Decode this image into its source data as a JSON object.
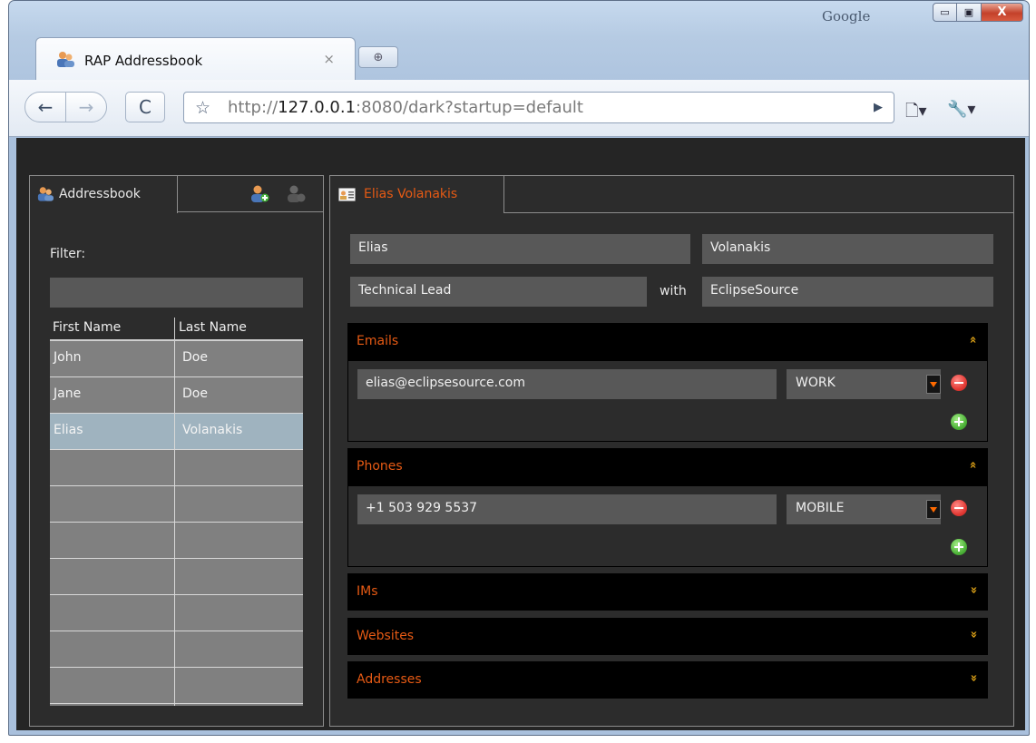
{
  "browser": {
    "tab_title": "RAP Addressbook",
    "tab_close": "×",
    "new_tab": "⊕",
    "corner_label": "Google",
    "window_buttons": {
      "minimize": "▭",
      "maximize": "▣",
      "close": "X"
    },
    "url_prefix": "http://",
    "url_host": "127.0.0.1",
    "url_rest": ":8080/dark?startup=default",
    "icons": {
      "back": "←",
      "forward": "→",
      "reload": "C",
      "star": "☆",
      "go": "▶",
      "page": "🗋▾",
      "tools": "🔧▾"
    }
  },
  "addressbook": {
    "tab_label": "Addressbook",
    "filter_label": "Filter:",
    "filter_value": "",
    "columns": [
      "First Name",
      "Last Name"
    ],
    "rows": [
      {
        "first": "John",
        "last": "Doe"
      },
      {
        "first": "Jane",
        "last": "Doe"
      },
      {
        "first": "Elias",
        "last": "Volanakis"
      },
      {
        "first": "",
        "last": ""
      },
      {
        "first": "",
        "last": ""
      },
      {
        "first": "",
        "last": ""
      },
      {
        "first": "",
        "last": ""
      },
      {
        "first": "",
        "last": ""
      },
      {
        "first": "",
        "last": ""
      },
      {
        "first": "",
        "last": ""
      }
    ],
    "selected_row": 2
  },
  "editor": {
    "tab_label": "Elias Volanakis",
    "first_name": "Elias",
    "last_name": "Volanakis",
    "job_title": "Technical Lead",
    "with_label": "with",
    "company": "EclipseSource",
    "sections": {
      "emails": {
        "title": "Emails",
        "chevron": "»",
        "value": "elias@eclipsesource.com",
        "type": "WORK"
      },
      "phones": {
        "title": "Phones",
        "chevron": "»",
        "value": "+1 503 929 5537",
        "type": "MOBILE"
      },
      "ims": {
        "title": "IMs",
        "chevron": "»"
      },
      "websites": {
        "title": "Websites",
        "chevron": "»"
      },
      "addresses": {
        "title": "Addresses",
        "chevron": "»"
      }
    }
  },
  "colors": {
    "accent": "#e65a14",
    "chevron": "#e6a818",
    "background": "#252525",
    "selection": "#9fb3bf"
  }
}
